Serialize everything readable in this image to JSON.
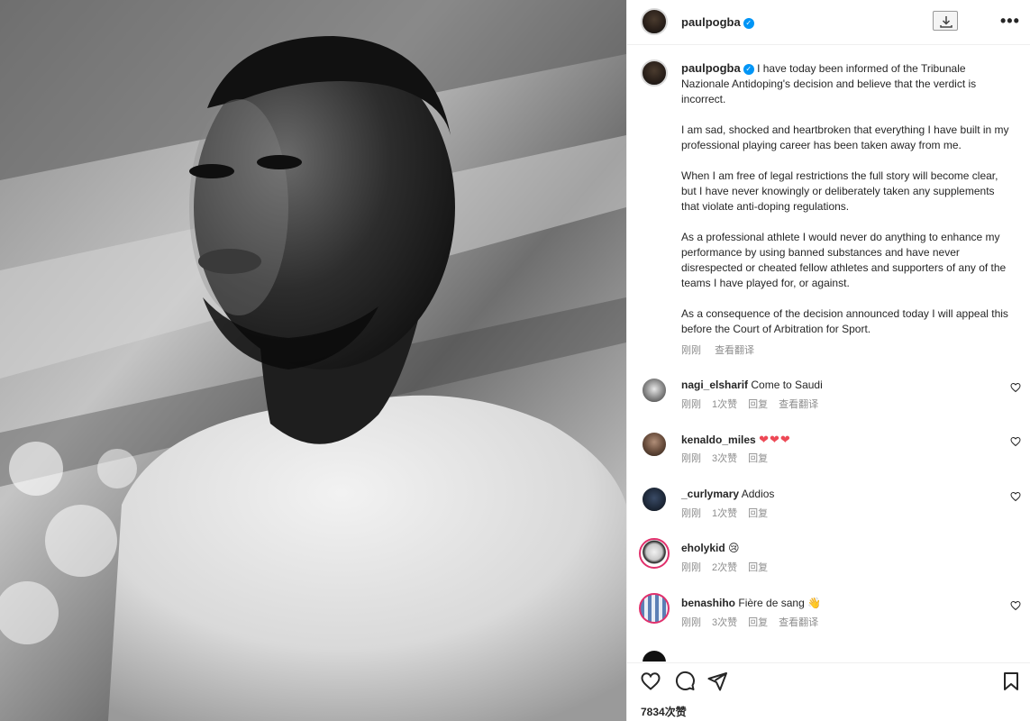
{
  "post": {
    "username": "paulpogba",
    "verified_glyph": "✓",
    "download_icon": "download-icon",
    "more_label": "•••"
  },
  "caption": {
    "username": "paulpogba",
    "paragraphs": [
      "I have today been informed of the Tribunale Nazionale Antidoping's decision and believe that the verdict is incorrect.",
      "I am sad, shocked and heartbroken that everything I have built in my professional playing career has been taken away from me.",
      "When I am free of legal restrictions the full story will become clear, but I have never knowingly or deliberately taken any supplements that violate anti-doping regulations.",
      "As a professional athlete I would never do anything to enhance my performance by using banned substances and have never disrespected or cheated fellow athletes and supporters of any of the teams I have played for, or against.",
      "As a consequence of the decision announced today I will appeal this before the Court of Arbitration for Sport."
    ],
    "time": "刚刚",
    "translate": "查看翻译"
  },
  "comments": [
    {
      "username": "nagi_elsharif",
      "text": "Come to Saudi",
      "time": "刚刚",
      "likes": "1次赞",
      "reply": "回复",
      "translate": "查看翻译"
    },
    {
      "username": "kenaldo_miles",
      "text": "❤❤❤",
      "time": "刚刚",
      "likes": "3次赞",
      "reply": "回复",
      "translate": ""
    },
    {
      "username": "_curlymary",
      "text": "Addios",
      "time": "刚刚",
      "likes": "1次赞",
      "reply": "回复",
      "translate": ""
    },
    {
      "username": "eholykid",
      "text": "😢",
      "time": "刚刚",
      "likes": "2次赞",
      "reply": "回复",
      "translate": ""
    },
    {
      "username": "benashiho",
      "text": "Fière de sang 👋",
      "time": "刚刚",
      "likes": "3次赞",
      "reply": "回复",
      "translate": "查看翻译"
    }
  ],
  "actions": {
    "like_icon": "heart-icon",
    "comment_icon": "comment-icon",
    "share_icon": "send-icon",
    "save_icon": "bookmark-icon",
    "likes_count": "7834次赞"
  },
  "colors": {
    "verified": "#0095f6",
    "muted": "#8e8e8e",
    "heart_red": "#ed4956",
    "story_ring": "#e1306c"
  }
}
